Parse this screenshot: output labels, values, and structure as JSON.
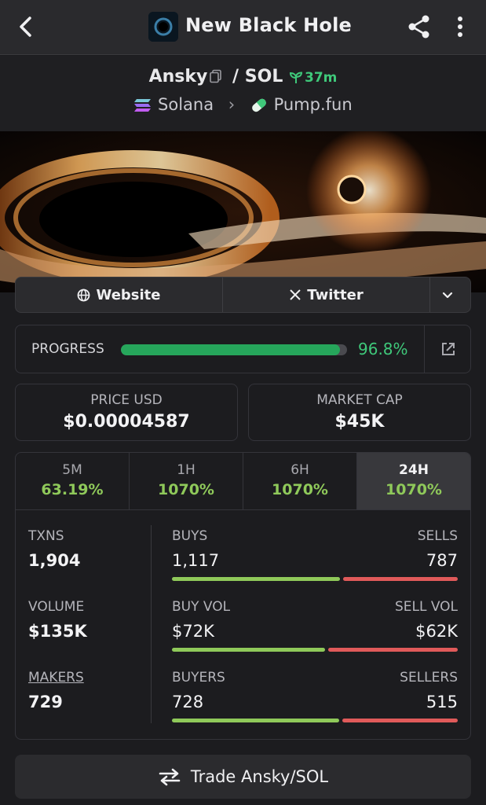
{
  "header": {
    "title": "New Black Hole"
  },
  "pair": {
    "token": "Ansky",
    "separator": "/",
    "quote": "SOL",
    "age": "37m",
    "chain": "Solana",
    "dex": "Pump.fun"
  },
  "links": {
    "website": "Website",
    "twitter": "Twitter"
  },
  "progress": {
    "label": "PROGRESS",
    "value": "96.8%",
    "fraction": 0.968
  },
  "stats": {
    "price_label": "PRICE USD",
    "price_value": "$0.00004587",
    "mcap_label": "MARKET CAP",
    "mcap_value": "$45K"
  },
  "timeframes": [
    {
      "label": "5M",
      "value": "63.19%"
    },
    {
      "label": "1H",
      "value": "1070%"
    },
    {
      "label": "6H",
      "value": "1070%"
    },
    {
      "label": "24H",
      "value": "1070%"
    }
  ],
  "metrics": {
    "txns_label": "TXNS",
    "txns_value": "1,904",
    "volume_label": "VOLUME",
    "volume_value": "$135K",
    "makers_label": "MAKERS",
    "makers_value": "729"
  },
  "splits": {
    "buys_label": "BUYS",
    "sells_label": "SELLS",
    "buys_value": "1,117",
    "sells_value": "787",
    "buys_share": 0.587,
    "buyvol_label": "BUY VOL",
    "sellvol_label": "SELL VOL",
    "buyvol_value": "$72K",
    "sellvol_value": "$62K",
    "buyvol_share": 0.537,
    "buyers_label": "BUYERS",
    "sellers_label": "SELLERS",
    "buyers_value": "728",
    "sellers_value": "515",
    "buyers_share": 0.586
  },
  "trade": {
    "label": "Trade Ansky/SOL"
  },
  "colors": {
    "buy": "#8fc95a",
    "sell": "#e05a5a",
    "progress": "#26a65b",
    "accent_green": "#3fc87a"
  }
}
